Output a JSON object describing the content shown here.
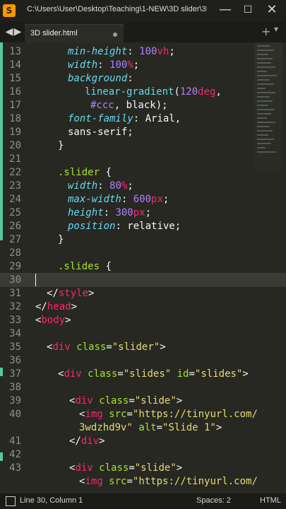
{
  "titlebar": {
    "title": "C:\\Users\\User\\Desktop\\Teaching\\1-NEW\\3D slider\\3D ...",
    "app_icon": "sublime-text-icon"
  },
  "tabs": {
    "active_tab": "3D slider.html",
    "plus": "+",
    "chevron": "▾"
  },
  "statusbar": {
    "position": "Line 30, Column 1",
    "spaces": "Spaces: 2",
    "syntax": "HTML"
  },
  "editor": {
    "lines": [
      {
        "n": "13",
        "text": "min-height: 100vh;"
      },
      {
        "n": "14",
        "text": "width: 100%;"
      },
      {
        "n": "15",
        "text": "background:"
      },
      {
        "n": "16",
        "text": "linear-gradient(120deg,"
      },
      {
        "n": "17",
        "text": "#ccc, black);"
      },
      {
        "n": "18",
        "text": "font-family: Arial,"
      },
      {
        "n": "19",
        "text": "sans-serif;"
      },
      {
        "n": "20",
        "text": "}"
      },
      {
        "n": "21",
        "text": ""
      },
      {
        "n": "22",
        "text": ".slider {"
      },
      {
        "n": "23",
        "text": "width: 80%;"
      },
      {
        "n": "24",
        "text": "max-width: 600px;"
      },
      {
        "n": "25",
        "text": "height: 300px;"
      },
      {
        "n": "26",
        "text": "position: relative;"
      },
      {
        "n": "27",
        "text": "}"
      },
      {
        "n": "28",
        "text": ""
      },
      {
        "n": "29",
        "text": ".slides {"
      },
      {
        "n": "30",
        "text": ""
      },
      {
        "n": "31",
        "text": "</style>"
      },
      {
        "n": "32",
        "text": "</head>"
      },
      {
        "n": "33",
        "text": "<body>"
      },
      {
        "n": "34",
        "text": ""
      },
      {
        "n": "35",
        "text": "<div class=\"slider\">"
      },
      {
        "n": "36",
        "text": ""
      },
      {
        "n": "37",
        "text": "<div class=\"slides\" id=\"slides\">"
      },
      {
        "n": "38",
        "text": ""
      },
      {
        "n": "39",
        "text": "<div class=\"slide\">"
      },
      {
        "n": "40",
        "text": "<img src=\"https://tinyurl.com/"
      },
      {
        "n": "",
        "text": "3wdzhd9v\" alt=\"Slide 1\">"
      },
      {
        "n": "41",
        "text": "</div>"
      },
      {
        "n": "42",
        "text": ""
      },
      {
        "n": "43",
        "text": "<div class=\"slide\">"
      },
      {
        "n": "",
        "text": "<img src=\"https://tinyurl.com/"
      }
    ]
  }
}
